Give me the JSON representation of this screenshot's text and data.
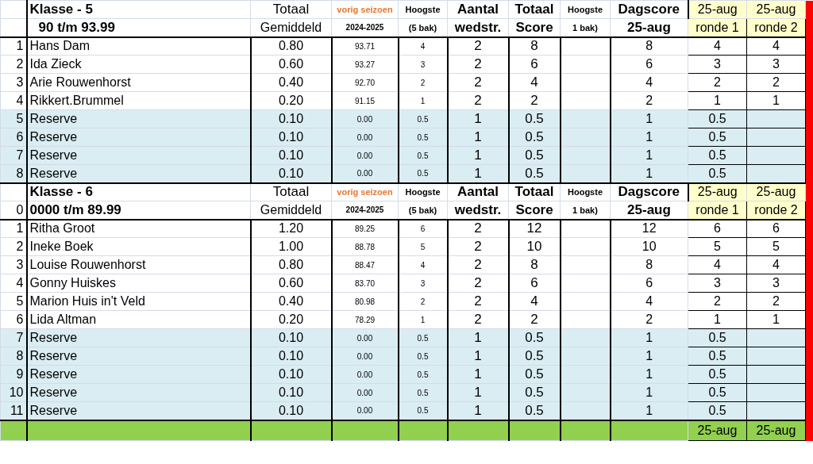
{
  "sections": [
    {
      "title": "Klasse - 5",
      "range": "90 t/m 93.99",
      "columns": [
        {
          "top": "Totaal",
          "bottom": "Gemiddeld"
        },
        {
          "top": "vorig seizoen",
          "bottom": "2024-2025"
        },
        {
          "top": "Hoogste",
          "bottom": "(5 bak)"
        },
        {
          "top": "Aantal",
          "bottom": "wedstr."
        },
        {
          "top": "Totaal",
          "bottom": "Score"
        },
        {
          "top": "Hoogste",
          "bottom": "1 bak)"
        },
        {
          "top": "Dagscore",
          "bottom": "25-aug"
        },
        {
          "top": "25-aug",
          "bottom": "ronde 1"
        },
        {
          "top": "25-aug",
          "bottom": "ronde 2"
        }
      ],
      "rows": [
        {
          "no": "1",
          "name": "Hans Dam",
          "average": "0.80",
          "previous": "93.71",
          "high_5": "4",
          "matches": "2",
          "total": "8",
          "day_score": "8",
          "round_1": "4",
          "round_2": "4",
          "reserve": false
        },
        {
          "no": "2",
          "name": "Ida Zieck",
          "average": "0.60",
          "previous": "93.27",
          "high_5": "3",
          "matches": "2",
          "total": "6",
          "day_score": "6",
          "round_1": "3",
          "round_2": "3",
          "reserve": false
        },
        {
          "no": "3",
          "name": "Arie Rouwenhorst",
          "average": "0.40",
          "previous": "92.70",
          "high_5": "2",
          "matches": "2",
          "total": "4",
          "day_score": "4",
          "round_1": "2",
          "round_2": "2",
          "reserve": false
        },
        {
          "no": "4",
          "name": "Rikkert.Brummel",
          "average": "0.20",
          "previous": "91.15",
          "high_5": "1",
          "matches": "2",
          "total": "2",
          "day_score": "2",
          "round_1": "1",
          "round_2": "1",
          "reserve": false
        },
        {
          "no": "5",
          "name": "Reserve",
          "average": "0.10",
          "previous": "0.00",
          "high_5": "0.5",
          "matches": "1",
          "total": "0.5",
          "day_score": "1",
          "round_1": "0.5",
          "reserve": true
        },
        {
          "no": "6",
          "name": "Reserve",
          "average": "0.10",
          "previous": "0.00",
          "high_5": "0.5",
          "matches": "1",
          "total": "0.5",
          "day_score": "1",
          "round_1": "0.5",
          "reserve": true
        },
        {
          "no": "7",
          "name": "Reserve",
          "average": "0.10",
          "previous": "0.00",
          "high_5": "0.5",
          "matches": "1",
          "total": "0.5",
          "day_score": "1",
          "round_1": "0.5",
          "reserve": true
        },
        {
          "no": "8",
          "name": "Reserve",
          "average": "0.10",
          "previous": "0.00",
          "high_5": "0.5",
          "matches": "1",
          "total": "0.5",
          "day_score": "1",
          "round_1": "0.5",
          "reserve": true
        }
      ]
    },
    {
      "title": "Klasse - 6",
      "index": "0",
      "range": "0000 t/m 89.99",
      "columns": [
        {
          "top": "Totaal",
          "bottom": "Gemiddeld"
        },
        {
          "top": "vorig seizoen",
          "bottom": "2024-2025"
        },
        {
          "top": "Hoogste",
          "bottom": "(5 bak)"
        },
        {
          "top": "Aantal",
          "bottom": "wedstr."
        },
        {
          "top": "Totaal",
          "bottom": "Score"
        },
        {
          "top": "Hoogste",
          "bottom": "1 bak)"
        },
        {
          "top": "Dagscore",
          "bottom": "25-aug"
        },
        {
          "top": "25-aug",
          "bottom": "ronde 1"
        },
        {
          "top": "25-aug",
          "bottom": "ronde 2"
        }
      ],
      "rows": [
        {
          "no": "1",
          "name": "Ritha Groot",
          "average": "1.20",
          "previous": "89.25",
          "high_5": "6",
          "matches": "2",
          "total": "12",
          "day_score": "12",
          "round_1": "6",
          "round_2": "6",
          "reserve": false
        },
        {
          "no": "2",
          "name": "Ineke Boek",
          "average": "1.00",
          "previous": "88.78",
          "high_5": "5",
          "matches": "2",
          "total": "10",
          "day_score": "10",
          "round_1": "5",
          "round_2": "5",
          "reserve": false
        },
        {
          "no": "3",
          "name": "Louise Rouwenhorst",
          "average": "0.80",
          "previous": "88.47",
          "high_5": "4",
          "matches": "2",
          "total": "8",
          "day_score": "8",
          "round_1": "4",
          "round_2": "4",
          "reserve": false
        },
        {
          "no": "4",
          "name": "Gonny Huiskes",
          "average": "0.60",
          "previous": "83.70",
          "high_5": "3",
          "matches": "2",
          "total": "6",
          "day_score": "6",
          "round_1": "3",
          "round_2": "3",
          "reserve": false
        },
        {
          "no": "5",
          "name": "Marion Huis in't Veld",
          "average": "0.40",
          "previous": "80.98",
          "high_5": "2",
          "matches": "2",
          "total": "4",
          "day_score": "4",
          "round_1": "2",
          "round_2": "2",
          "reserve": false
        },
        {
          "no": "6",
          "name": "Lida Altman",
          "average": "0.20",
          "previous": "78.29",
          "high_5": "1",
          "matches": "2",
          "total": "2",
          "day_score": "2",
          "round_1": "1",
          "round_2": "1",
          "reserve": false
        },
        {
          "no": "7",
          "name": "Reserve",
          "average": "0.10",
          "previous": "0.00",
          "high_5": "0.5",
          "matches": "1",
          "total": "0.5",
          "day_score": "1",
          "round_1": "0.5",
          "reserve": true
        },
        {
          "no": "8",
          "name": "Reserve",
          "average": "0.10",
          "previous": "0.00",
          "high_5": "0.5",
          "matches": "1",
          "total": "0.5",
          "day_score": "1",
          "round_1": "0.5",
          "reserve": true
        },
        {
          "no": "9",
          "name": "Reserve",
          "average": "0.10",
          "previous": "0.00",
          "high_5": "0.5",
          "matches": "1",
          "total": "0.5",
          "day_score": "1",
          "round_1": "0.5",
          "reserve": true
        },
        {
          "no": "10",
          "name": "Reserve",
          "average": "0.10",
          "previous": "0.00",
          "high_5": "0.5",
          "matches": "1",
          "total": "0.5",
          "day_score": "1",
          "round_1": "0.5",
          "reserve": true
        },
        {
          "no": "11",
          "name": "Reserve",
          "average": "0.10",
          "previous": "0.00",
          "high_5": "0.5",
          "matches": "1",
          "total": "0.5",
          "day_score": "1",
          "round_1": "0.5",
          "reserve": true
        }
      ]
    }
  ],
  "footer": {
    "round_1": "25-aug",
    "round_2": "25-aug"
  }
}
